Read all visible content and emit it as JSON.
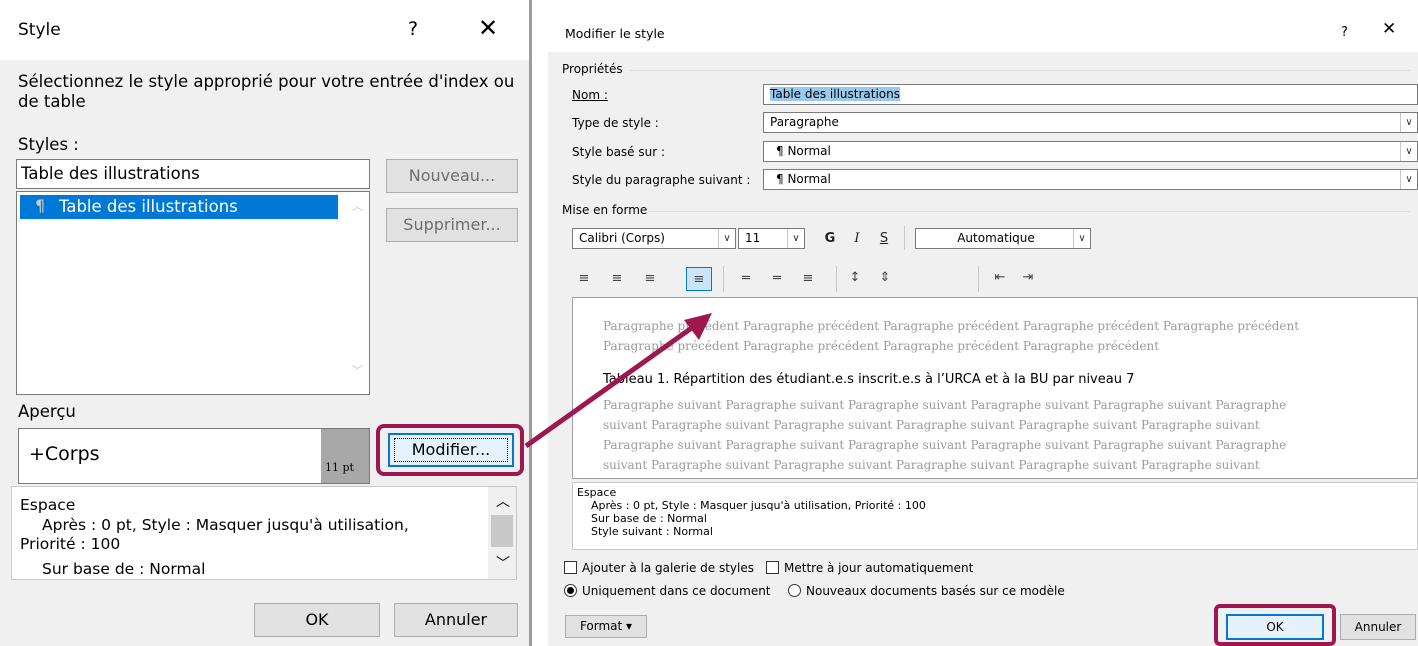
{
  "left": {
    "title": "Style",
    "help": "?",
    "close": "✕",
    "instruction": "Sélectionnez le style approprié pour votre entrée d'index ou de table",
    "styles_label": "Styles :",
    "style_input": "Table des illustrations",
    "list_items": [
      "Table des illustrations"
    ],
    "new_button": "Nouveau...",
    "delete_button": "Supprimer...",
    "preview_label": "Aperçu",
    "preview_font": "+Corps",
    "preview_size": "11 pt",
    "modify_button": "Modifier...",
    "desc_line1": "Espace",
    "desc_line2": "Après : 0 pt, Style : Masquer jusqu'à utilisation,",
    "desc_line3": "Priorité : 100",
    "desc_line4": "Sur base de : Normal",
    "ok": "OK",
    "cancel": "Annuler"
  },
  "right": {
    "title": "Modifier le style",
    "help": "?",
    "close": "✕",
    "properties_label": "Propriétés",
    "name_label": "Nom :",
    "name_value": "Table des illustrations",
    "type_label": "Type de style :",
    "type_value": "Paragraphe",
    "based_label": "Style basé sur :",
    "based_value": "Normal",
    "next_label": "Style du paragraphe suivant :",
    "next_value": "Normal",
    "format_section": "Mise en forme",
    "font": "Calibri (Corps)",
    "size": "11",
    "bold": "G",
    "italic": "I",
    "underline": "S",
    "color": "Automatique",
    "preview_prev1": "Paragraphe précédent Paragraphe précédent Paragraphe précédent Paragraphe précédent Paragraphe précédent",
    "preview_prev2": "Paragraphe précédent Paragraphe précédent Paragraphe précédent Paragraphe précédent",
    "preview_main": "Tableau 1. Répartition des étudiant.e.s inscrit.e.s à l’URCA et à la BU par niveau   7",
    "preview_next1": "Paragraphe suivant Paragraphe suivant Paragraphe suivant Paragraphe suivant Paragraphe suivant Paragraphe",
    "preview_next2": "suivant Paragraphe suivant Paragraphe suivant Paragraphe suivant Paragraphe suivant Paragraphe suivant",
    "preview_next3": "Paragraphe suivant Paragraphe suivant Paragraphe suivant Paragraphe suivant Paragraphe suivant Paragraphe",
    "preview_next4": "suivant Paragraphe suivant Paragraphe suivant Paragraphe suivant Paragraphe suivant Paragraphe suivant",
    "desc_line1": "Espace",
    "desc_line2": "Après : 0 pt, Style : Masquer jusqu'à utilisation, Priorité : 100",
    "desc_line3": "Sur base de : Normal",
    "desc_line4": "Style suivant : Normal",
    "add_gallery": "Ajouter à la galerie de styles",
    "auto_update": "Mettre à jour automatiquement",
    "only_doc": "Uniquement dans ce document",
    "new_docs": "Nouveaux documents basés sur ce modèle",
    "format_button": "Format ▾",
    "ok": "OK",
    "cancel": "Annuler"
  },
  "colors": {
    "selection": "#0078d7",
    "highlight_box": "#a0174f",
    "name_highlight": "#99c9ef"
  }
}
